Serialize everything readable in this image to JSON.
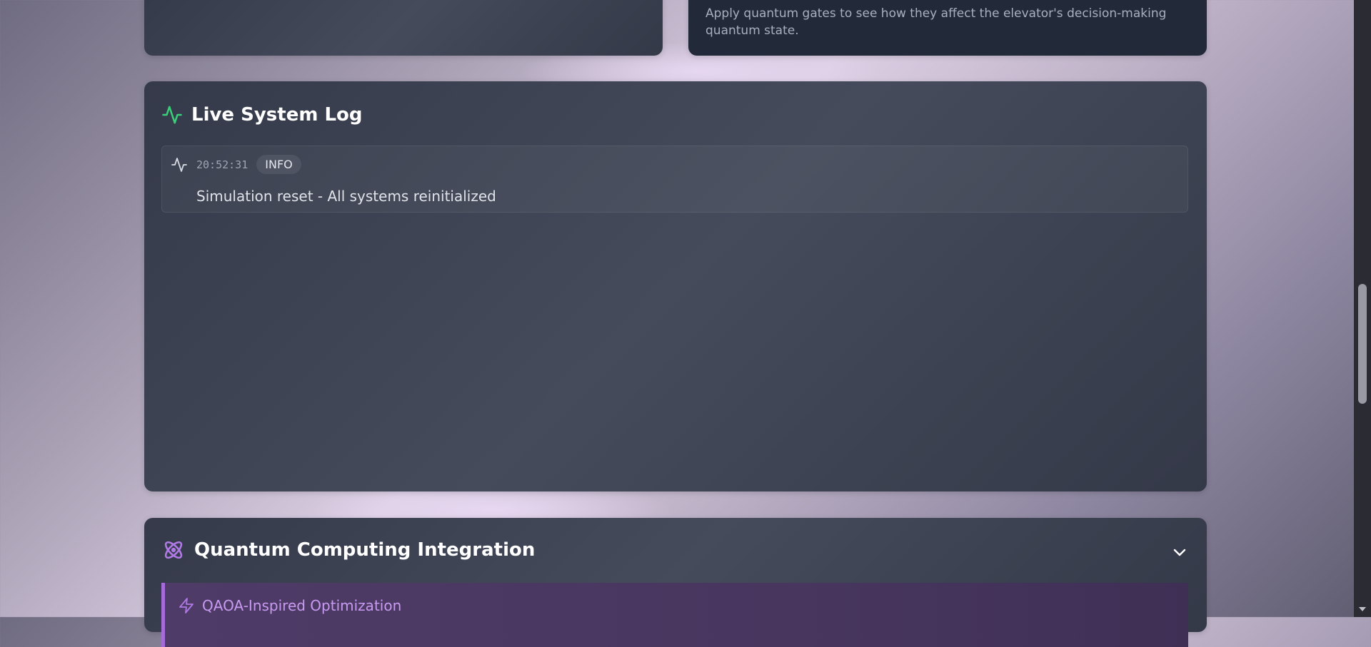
{
  "gates_card": {
    "description": "Apply quantum gates to see how they affect the elevator's decision-making quantum state."
  },
  "log_card": {
    "title": "Live System Log",
    "entries": [
      {
        "time": "20:52:31",
        "level": "INFO",
        "message": "Simulation reset - All systems reinitialized"
      }
    ]
  },
  "quantum_card": {
    "title": "Quantum Computing Integration",
    "section": {
      "title": "QAOA-Inspired Optimization"
    }
  },
  "colors": {
    "activity_green": "#3ad07a",
    "quantum_purple": "#b07ae6",
    "accent_border": "#a66bdb"
  },
  "icons": {
    "log_header": "activity-icon",
    "log_entry": "activity-icon",
    "quantum_header": "atom-icon",
    "section": "zap-icon",
    "collapse": "chevron-down-icon"
  }
}
